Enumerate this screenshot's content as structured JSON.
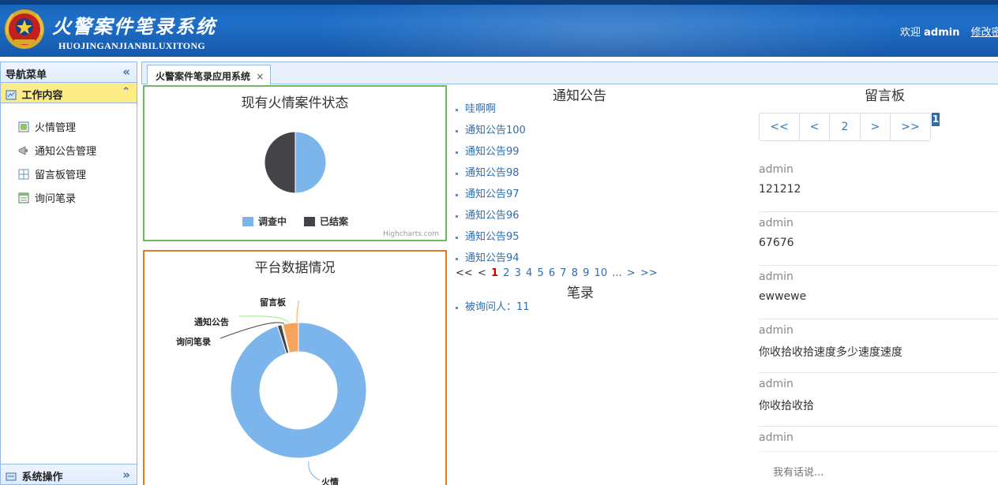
{
  "header": {
    "title": "火警案件笔录系统",
    "subtitle": "HUOJINGANJIANBILUXITONG",
    "welcome_prefix": "欢迎",
    "username": "admin",
    "change_password": "修改密码"
  },
  "sidebar": {
    "nav_title": "导航菜单",
    "section_title": "工作内容",
    "items": [
      {
        "label": "火情管理",
        "icon": "fire-manage-icon"
      },
      {
        "label": "通知公告管理",
        "icon": "megaphone-icon"
      },
      {
        "label": "留言板管理",
        "icon": "grid-icon"
      },
      {
        "label": "询问笔录",
        "icon": "form-icon"
      }
    ],
    "system_section": "系统操作"
  },
  "tabs": [
    {
      "label": "火警案件笔录应用系统",
      "close": "×"
    }
  ],
  "fire_status": {
    "title": "现有火情案件状态",
    "legend": [
      "调查中",
      "已结案"
    ],
    "credit": "Highcharts.com"
  },
  "platform": {
    "title": "平台数据情况",
    "labels": {
      "board": "留言板",
      "notice": "通知公告",
      "record": "询问笔录",
      "fire": "火情"
    }
  },
  "chart_data": [
    {
      "type": "pie",
      "title": "现有火情案件状态",
      "labels": [
        "调查中",
        "已结案"
      ],
      "values": [
        50,
        50
      ],
      "colors": [
        "#7cb5ec",
        "#434348"
      ],
      "legend": "bottom"
    },
    {
      "type": "pie",
      "title": "平台数据情况",
      "donut": true,
      "labels": [
        "火情",
        "询问笔录",
        "通知公告",
        "留言板"
      ],
      "values": [
        95,
        1,
        0.3,
        3.7
      ],
      "colors": [
        "#7cb5ec",
        "#434348",
        "#90ed7d",
        "#f7a35c"
      ]
    }
  ],
  "notice": {
    "title": "通知公告",
    "items": [
      "哇啊啊",
      "通知公告100",
      "通知公告99",
      "通知公告98",
      "通知公告97",
      "通知公告96",
      "通知公告95",
      "通知公告94"
    ],
    "pager": {
      "first": "<<",
      "prev": "<",
      "current": "1",
      "pages": [
        "2",
        "3",
        "4",
        "5",
        "6",
        "7",
        "8",
        "9",
        "10",
        "..."
      ],
      "next": ">",
      "last": ">>"
    }
  },
  "records": {
    "title": "笔录",
    "items": [
      "被询问人：11"
    ]
  },
  "board": {
    "title": "留言板",
    "pager": [
      "<<",
      "<",
      "2",
      ">",
      ">>"
    ],
    "page_marker": "1",
    "messages": [
      {
        "user": "admin",
        "text": "121212"
      },
      {
        "user": "admin",
        "text": "67676"
      },
      {
        "user": "admin",
        "text": "ewwewe"
      },
      {
        "user": "admin",
        "text": "你收拾收拾速度多少速度速度"
      },
      {
        "user": "admin",
        "text": "你收拾收拾"
      },
      {
        "user": "admin",
        "text": ""
      }
    ],
    "input_placeholder": "我有话说..."
  },
  "colors": {
    "header_blue": "#1e6fc9",
    "fire_panel_border": "#6cbd5e",
    "platform_panel_border": "#e07a2b",
    "link_blue": "#2e6db1",
    "active_section": "#fbec88"
  }
}
